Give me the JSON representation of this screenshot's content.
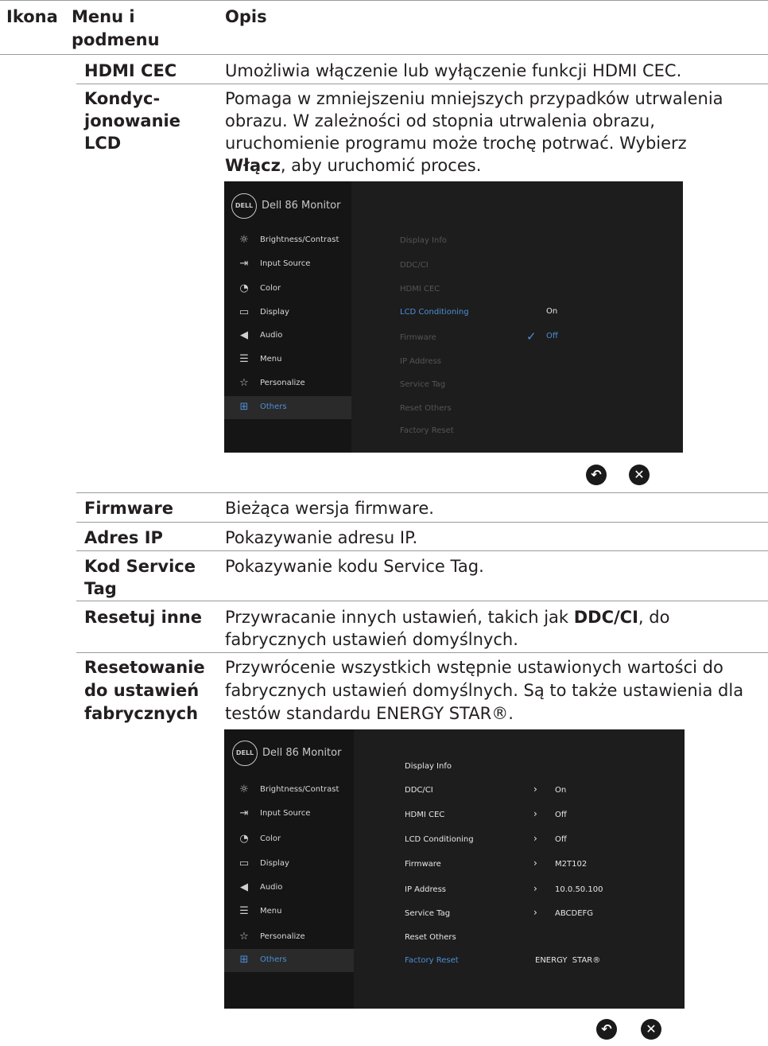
{
  "header": {
    "col_icon": "Ikona",
    "col_menu_line1": "Menu i",
    "col_menu_line2": "podmenu",
    "col_desc": "Opis"
  },
  "rows": {
    "hdmi_cec": {
      "term": "HDMI CEC",
      "desc": "Umożliwia włączenie lub wyłączenie funkcji HDMI CEC."
    },
    "lcd": {
      "term_l1": "Kondyc-",
      "term_l2": "jonowanie",
      "term_l3": "LCD",
      "desc_l1": "Pomaga w zmniejszeniu mniejszych przypadków utrwalenia",
      "desc_l2": "obrazu. W zależności od stopnia utrwalenia obrazu,",
      "desc_l3": "uruchomienie programu może trochę potrwać. Wybierz",
      "desc_bold": "Włącz",
      "desc_l4_rest": ", aby uruchomić proces."
    },
    "firmware": {
      "term": "Firmware",
      "desc": "Bieżąca wersja firmware."
    },
    "ip": {
      "term": "Adres IP",
      "desc": "Pokazywanie adresu IP."
    },
    "service_tag": {
      "term_l1": "Kod Service",
      "term_l2": "Tag",
      "desc": "Pokazywanie kodu Service Tag."
    },
    "reset_others": {
      "term": "Resetuj inne",
      "desc_l1_a": "Przywracanie innych ustawień, takich jak ",
      "desc_bold": "DDC/CI",
      "desc_l1_b": ", do",
      "desc_l2": "fabrycznych ustawień domyślnych."
    },
    "factory_reset": {
      "term_l1": "Resetowanie",
      "term_l2": "do ustawień",
      "term_l3": "fabrycznych",
      "desc_l1": "Przywrócenie wszystkich wstępnie ustawionych wartości do",
      "desc_l2": "fabrycznych ustawień domyślnych. Są to także ustawienia dla",
      "desc_l3": "testów standardu ENERGY STAR®."
    }
  },
  "osd": {
    "logo": "DELL",
    "model": "Dell 86 Monitor",
    "sidebar": [
      "Brightness/Contrast",
      "Input Source",
      "Color",
      "Display",
      "Audio",
      "Menu",
      "Personalize",
      "Others"
    ],
    "icons": [
      "brightness-icon",
      "input-source-icon",
      "color-icon",
      "display-icon",
      "audio-icon",
      "menu-icon",
      "personalize-icon",
      "others-icon"
    ],
    "submenu": [
      "Display Info",
      "DDC/CI",
      "HDMI CEC",
      "LCD Conditioning",
      "Firmware",
      "IP Address",
      "Service Tag",
      "Reset Others",
      "Factory Reset"
    ],
    "lcd_options": {
      "on": "On",
      "off": "Off",
      "check": "✓"
    },
    "values": {
      "ddc": "On",
      "hdmi": "Off",
      "lcd": "Off",
      "firmware": "M2T102",
      "ip": "10.0.50.100",
      "service_tag": "ABCDEFG",
      "factory": "ENERGY  STAR®"
    },
    "colors": {
      "bg": "#1d1d1d",
      "sidebar": "#151515",
      "accent": "#4e8ed6"
    }
  },
  "buttons": {
    "back": "↶",
    "close": "✕"
  }
}
